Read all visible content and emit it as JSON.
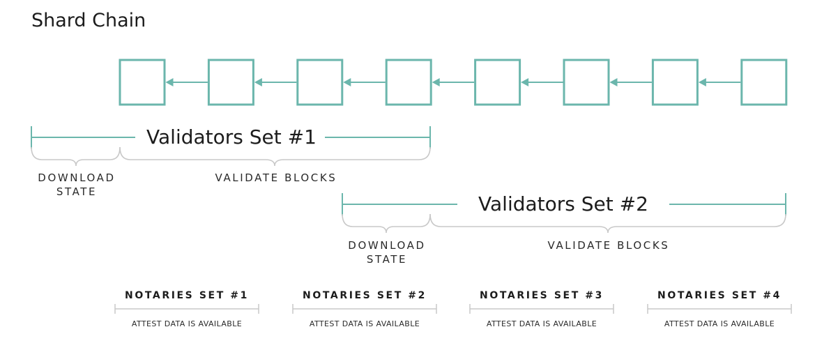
{
  "title": "Shard Chain",
  "chain": {
    "block_count": 8,
    "color": "#6bb6ac"
  },
  "validators": [
    {
      "label": "Validators Set #1",
      "download_label_line1": "DOWNLOAD",
      "download_label_line2": "STATE",
      "validate_label": "VALIDATE BLOCKS"
    },
    {
      "label": "Validators Set #2",
      "download_label_line1": "DOWNLOAD",
      "download_label_line2": "STATE",
      "validate_label": "VALIDATE BLOCKS"
    }
  ],
  "notaries": [
    {
      "label": "NOTARIES SET #1",
      "sub": "ATTEST DATA IS AVAILABLE"
    },
    {
      "label": "NOTARIES SET #2",
      "sub": "ATTEST DATA IS AVAILABLE"
    },
    {
      "label": "NOTARIES SET #3",
      "sub": "ATTEST DATA IS AVAILABLE"
    },
    {
      "label": "NOTARIES SET #4",
      "sub": "ATTEST DATA IS AVAILABLE"
    }
  ],
  "colors": {
    "teal": "#6bb6ac",
    "brace": "#c8c8c8",
    "text": "#1c1c1c"
  }
}
